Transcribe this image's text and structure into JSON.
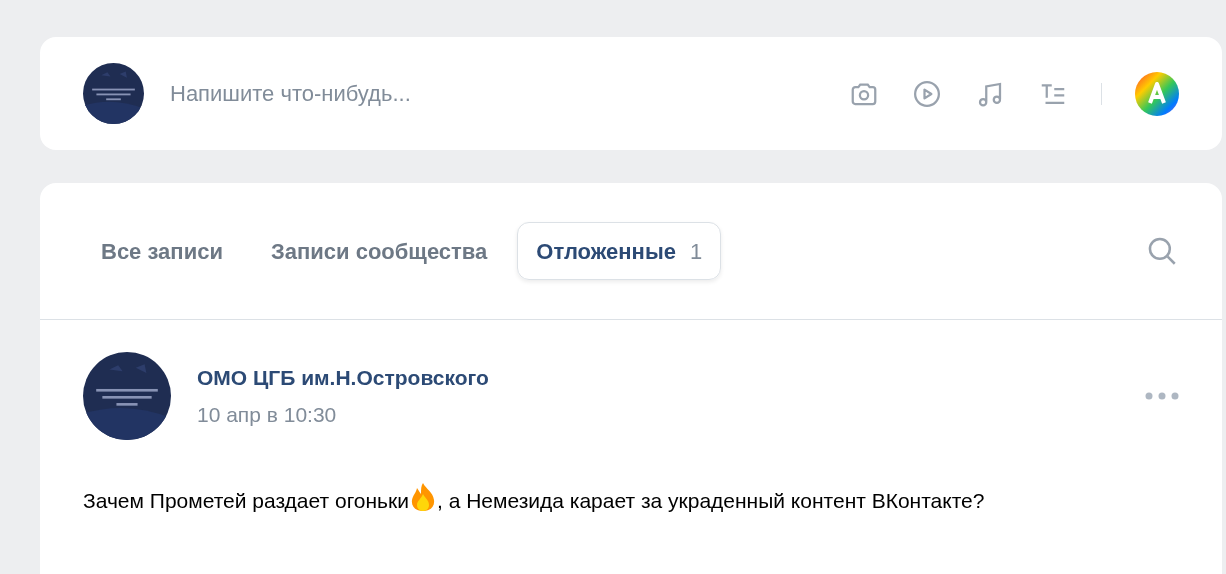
{
  "composer": {
    "placeholder": "Напишите что-нибудь..."
  },
  "tabs": [
    {
      "label": "Все записи",
      "selected": false
    },
    {
      "label": "Записи сообщества",
      "selected": false
    },
    {
      "label": "Отложенные",
      "count": "1",
      "selected": true
    }
  ],
  "post": {
    "author": "ОМО ЦГБ им.Н.Островского",
    "date": "10 апр в 10:30",
    "text_before": "Зачем Прометей раздает огоньки",
    "text_after": ", а Немезида карает за украденный контент ВКонтакте?"
  }
}
